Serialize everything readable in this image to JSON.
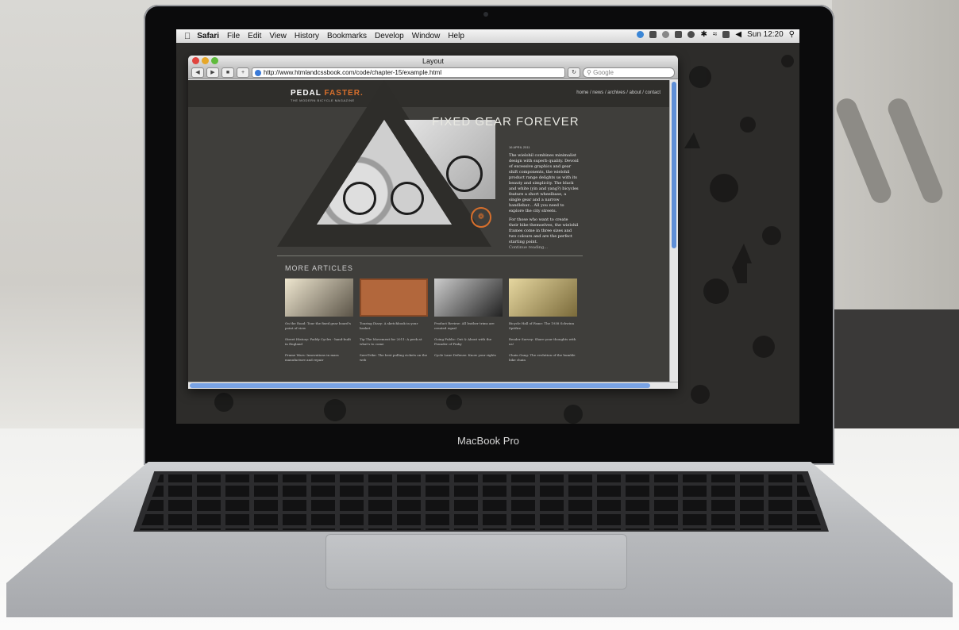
{
  "menubar": {
    "app_name": "Safari",
    "menus": [
      "File",
      "Edit",
      "View",
      "History",
      "Bookmarks",
      "Develop",
      "Window",
      "Help"
    ],
    "clock": "Sun 12:20"
  },
  "browser": {
    "window_title": "Layout",
    "url": "http://www.htmlandcssbook.com/code/chapter-15/example.html",
    "search_placeholder": "Google"
  },
  "site": {
    "logo_main": "PEDAL ",
    "logo_accent": "FASTER.",
    "tagline": "THE MODERN BICYCLE MAGAZINE",
    "nav": "home / news / archives / about / contact",
    "hero_title": "FIXED GEAR FOREVER",
    "date": "16 APRIL 2011",
    "paragraph1": "The wielohil combines minimalist design with superb quality. Devoid of excessive graphics and gear shift components, the wielohil product range delights us with its beauty and simplicity. The black and white (yin and yang?) bicycles feature a short wheelbase, a single gear and a narrow handlebar... All you need to explore the city streets.",
    "paragraph2": "For those who want to create their bike themselves, the wielohil frames come in three sizes and two colours and are the perfect starting point.",
    "continue": "Continue reading...",
    "more_title": "MORE ARTICLES",
    "articles": [
      [
        "On the Road: Tour the fixed gear board's point of view",
        "Street History: Paddy Cycles - hand-built in England",
        "Frame Wars: Innovations in mass manufacture and repair"
      ],
      [
        "Touring Diary: A sketchbook in your basket",
        "Tip The Movement for 2011: A peek at what's to come",
        "SaveTrike: The best pulling rickets on the web"
      ],
      [
        "Product Review: All leather trims are created equal",
        "Going Public: Out & About with the Founder of Pinky",
        "Cycle Lane Defense: Know your rights"
      ],
      [
        "Bicycle Hall of Fame: The 1938 Schwinn Spitfire",
        "Reader Survey: Share your thoughts with us!",
        "Chain Gang: The evolution of the humble bike chain"
      ]
    ]
  },
  "laptop": {
    "model_label": "MacBook Pro"
  },
  "colors": {
    "accent": "#d76f2c",
    "page_bg": "#3f3e3b",
    "header_bg": "#2f2e2b"
  }
}
